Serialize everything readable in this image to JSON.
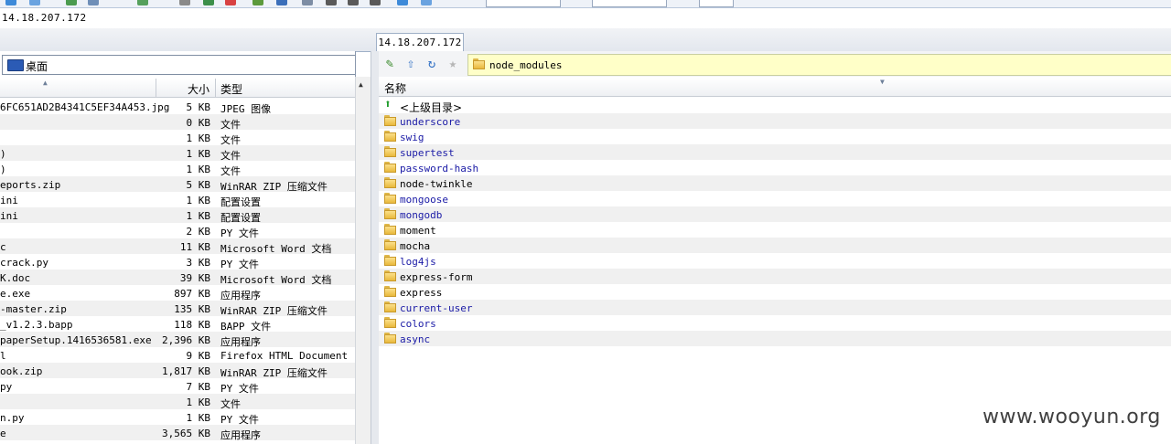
{
  "address": "14.18.207.172",
  "tab_label": "14.18.207.172",
  "left": {
    "drive_label": "桌面",
    "columns": {
      "size": "大小",
      "type": "类型"
    },
    "rows": [
      {
        "name": "6FC651AD2B4341C5EF34A453.jpg",
        "size": "5 KB",
        "type": "JPEG 图像"
      },
      {
        "name": "",
        "size": "0 KB",
        "type": "文件"
      },
      {
        "name": "",
        "size": "1 KB",
        "type": "文件"
      },
      {
        "name": ")",
        "size": "1 KB",
        "type": "文件"
      },
      {
        "name": ")",
        "size": "1 KB",
        "type": "文件"
      },
      {
        "name": "eports.zip",
        "size": "5 KB",
        "type": "WinRAR ZIP 压缩文件"
      },
      {
        "name": "ini",
        "size": "1 KB",
        "type": "配置设置"
      },
      {
        "name": "ini",
        "size": "1 KB",
        "type": "配置设置"
      },
      {
        "name": "",
        "size": "2 KB",
        "type": "PY 文件"
      },
      {
        "name": "c",
        "size": "11 KB",
        "type": "Microsoft Word 文档"
      },
      {
        "name": "crack.py",
        "size": "3 KB",
        "type": "PY 文件"
      },
      {
        "name": "K.doc",
        "size": "39 KB",
        "type": "Microsoft Word 文档"
      },
      {
        "name": "e.exe",
        "size": "897 KB",
        "type": "应用程序"
      },
      {
        "name": "-master.zip",
        "size": "135 KB",
        "type": "WinRAR ZIP 压缩文件"
      },
      {
        "name": "_v1.2.3.bapp",
        "size": "118 KB",
        "type": "BAPP 文件"
      },
      {
        "name": "paperSetup.1416536581.exe",
        "size": "2,396 KB",
        "type": "应用程序"
      },
      {
        "name": "l",
        "size": "9 KB",
        "type": "Firefox HTML Document"
      },
      {
        "name": "ook.zip",
        "size": "1,817 KB",
        "type": "WinRAR ZIP 压缩文件"
      },
      {
        "name": "py",
        "size": "7 KB",
        "type": "PY 文件"
      },
      {
        "name": "",
        "size": "1 KB",
        "type": "文件"
      },
      {
        "name": "n.py",
        "size": "1 KB",
        "type": "PY 文件"
      },
      {
        "name": "e",
        "size": "3,565 KB",
        "type": "应用程序"
      }
    ]
  },
  "right": {
    "path": "node_modules",
    "column_name": "名称",
    "parent_label": "<上级目录>",
    "folders": [
      {
        "name": "underscore",
        "color": "#1a1aa6"
      },
      {
        "name": "swig",
        "color": "#1a1aa6"
      },
      {
        "name": "supertest",
        "color": "#1a1aa6"
      },
      {
        "name": "password-hash",
        "color": "#1a1aa6"
      },
      {
        "name": "node-twinkle",
        "color": "#000000"
      },
      {
        "name": "mongoose",
        "color": "#1a1aa6"
      },
      {
        "name": "mongodb",
        "color": "#1a1aa6"
      },
      {
        "name": "moment",
        "color": "#000000"
      },
      {
        "name": "mocha",
        "color": "#000000"
      },
      {
        "name": "log4js",
        "color": "#1a1aa6"
      },
      {
        "name": "express-form",
        "color": "#000000"
      },
      {
        "name": "express",
        "color": "#000000"
      },
      {
        "name": "current-user",
        "color": "#1a1aa6"
      },
      {
        "name": "colors",
        "color": "#1a1aa6"
      },
      {
        "name": "async",
        "color": "#1a1aa6"
      }
    ]
  },
  "watermark": "www.wooyun.org"
}
